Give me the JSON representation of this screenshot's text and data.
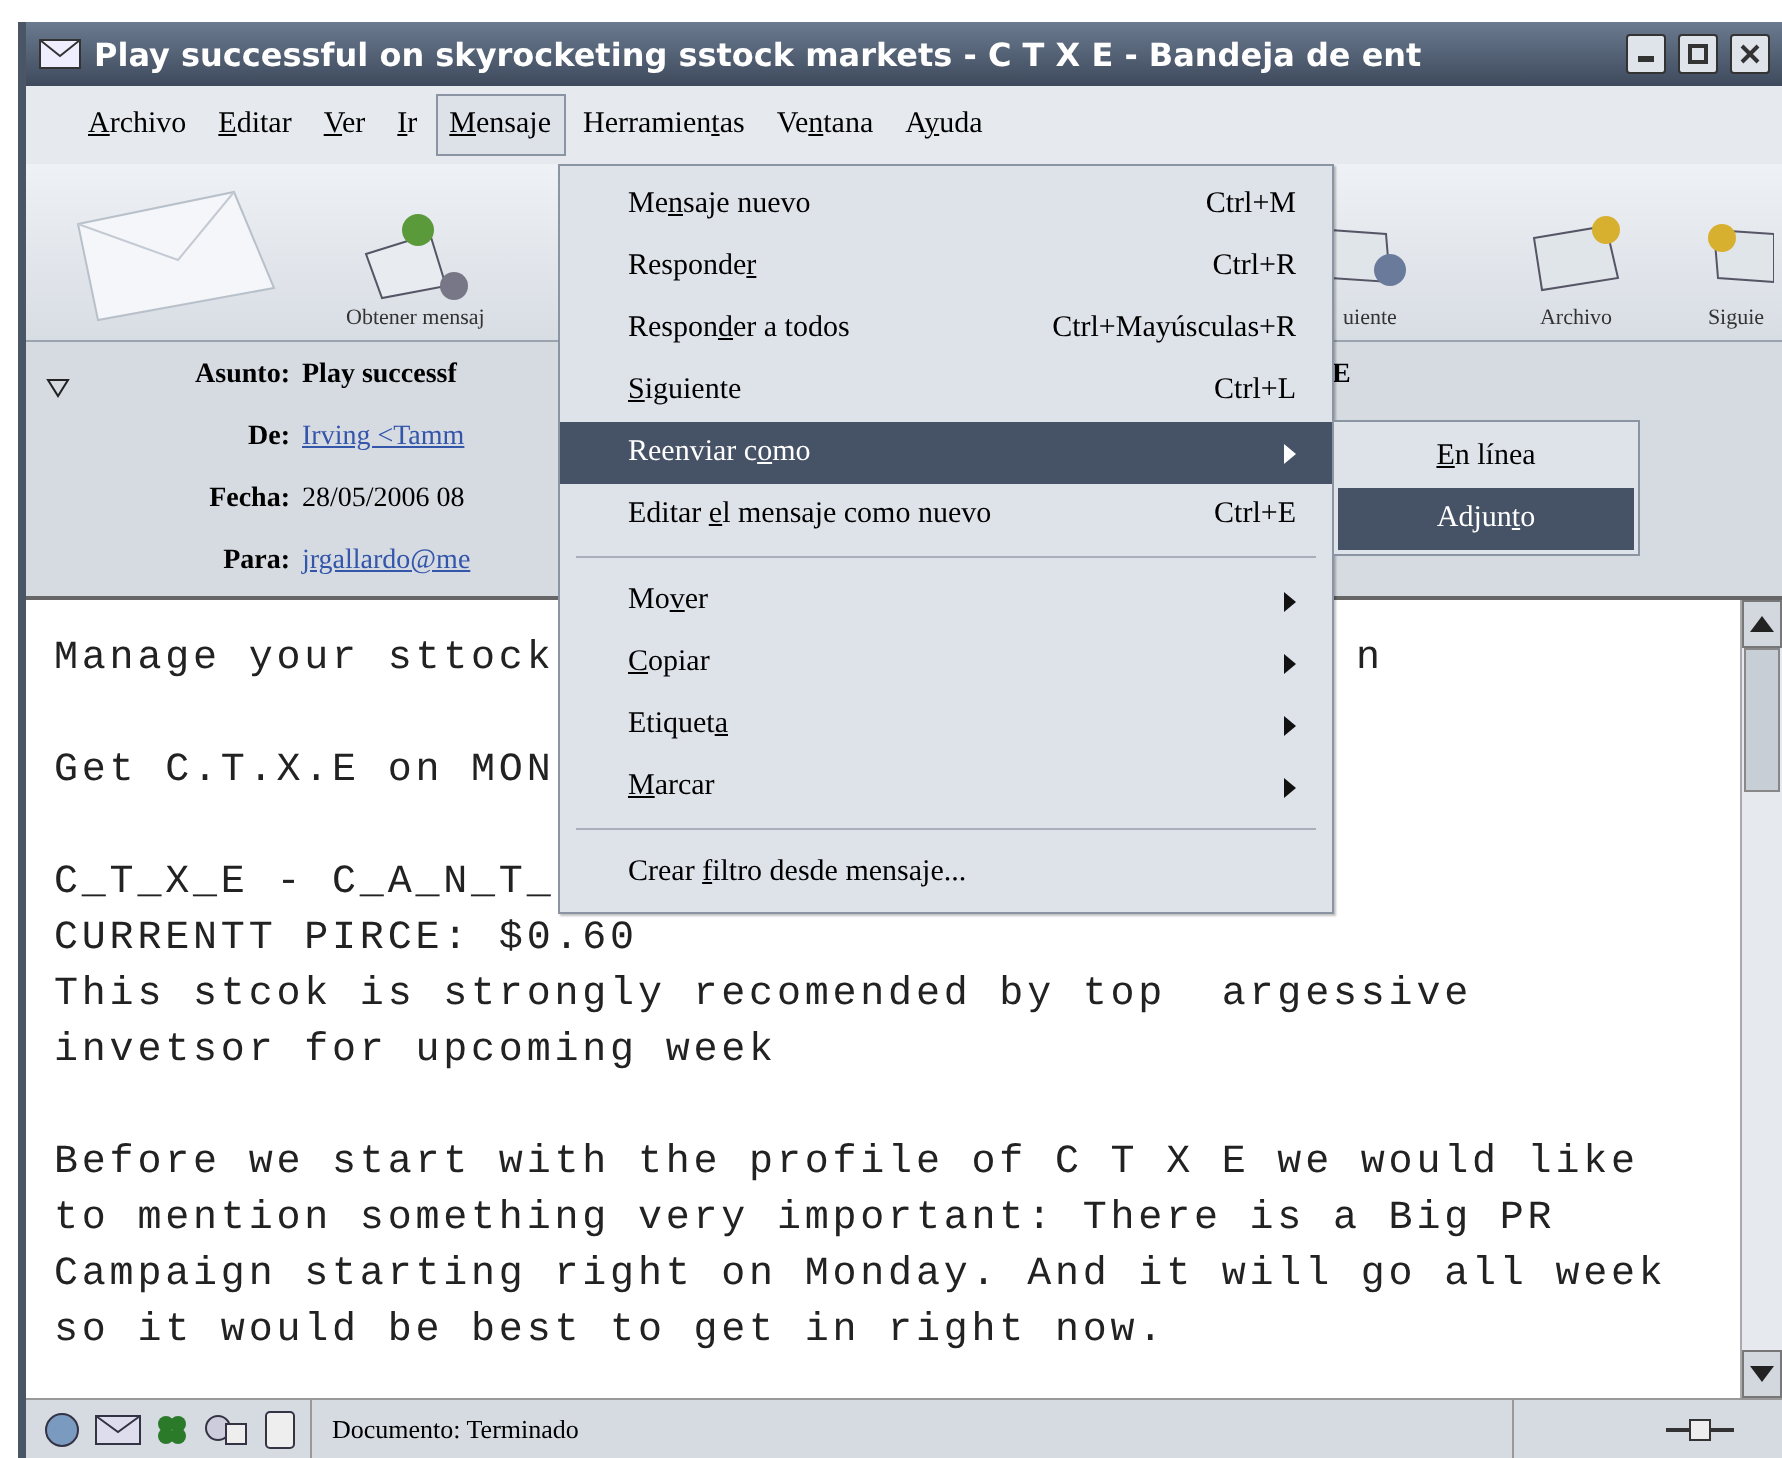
{
  "window": {
    "title": "Play successful on skyrocketing sstock markets - C T X E - Bandeja de ent"
  },
  "menubar": [
    {
      "label": {
        "key": "A",
        "post": "rchivo"
      },
      "selected": false
    },
    {
      "label": {
        "key": "E",
        "post": "ditar"
      },
      "selected": false
    },
    {
      "label": {
        "key": "V",
        "post": "er"
      },
      "selected": false
    },
    {
      "label": {
        "key": "I",
        "post": "r"
      },
      "selected": false
    },
    {
      "label": {
        "key": "M",
        "post": "ensaje"
      },
      "selected": true
    },
    {
      "label": {
        "pre": "Herramien",
        "key": "t",
        "post": "as"
      },
      "selected": false
    },
    {
      "label": {
        "pre": "Ve",
        "key": "n",
        "post": "tana"
      },
      "selected": false
    },
    {
      "label": {
        "pre": "A",
        "key": "y",
        "post": "uda"
      },
      "selected": false
    }
  ],
  "toolbar": [
    {
      "kind": "get",
      "label": "Obtener mensaj"
    },
    {
      "kind": "next",
      "label": "uiente"
    },
    {
      "kind": "file",
      "label": "Archivo"
    },
    {
      "kind": "next2",
      "label": "Siguie"
    }
  ],
  "header": {
    "expanded": true,
    "fields": [
      {
        "kind": "bold",
        "label": "Asunto:",
        "value": "Play successf",
        "tail": "E"
      },
      {
        "kind": "link",
        "label": "De:",
        "value": "Irving <Tamm"
      },
      {
        "kind": "plain",
        "label": "Fecha:",
        "value": "28/05/2006 08"
      },
      {
        "kind": "link",
        "label": "Para:",
        "value": "jrgallardo@me"
      }
    ]
  },
  "body": [
    [
      {
        "text": "Manage your sttock",
        "tail": "n"
      }
    ],
    [
      {
        "text": "Get C.T.X.E on MON"
      }
    ],
    [
      {
        "text": "C_T_X_E - C_A_N_T_"
      },
      {
        "text": "CURRENTT PIRCE: $0.60"
      },
      {
        "text": "This stcok is strongly recomended by top  argessive"
      },
      {
        "text": "invetsor for upcoming week"
      }
    ],
    [
      {
        "text": "Before we start with the profile of C T X E we would like"
      },
      {
        "text": "to mention something very important: There is a Big PR"
      },
      {
        "text": "Campaign starting right on Monday. And it will go all week"
      },
      {
        "text": "so it would be best to get in right now."
      }
    ]
  ],
  "menu": [
    {
      "kind": "item",
      "label": {
        "pre": "Me",
        "key": "n",
        "post": "saje nuevo"
      },
      "shortcut": "Ctrl+M",
      "selected": false
    },
    {
      "kind": "item",
      "label": {
        "pre": "Responde",
        "key": "r"
      },
      "shortcut": "Ctrl+R",
      "selected": false
    },
    {
      "kind": "item",
      "label": {
        "pre": "Respon",
        "key": "d",
        "post": "er a todos"
      },
      "shortcut": "Ctrl+Mayúsculas+R",
      "selected": false
    },
    {
      "kind": "item",
      "label": {
        "key": "S",
        "post": "iguiente"
      },
      "shortcut": "Ctrl+L",
      "selected": false
    },
    {
      "kind": "submenu",
      "label": {
        "pre": "Reenviar c",
        "key": "o",
        "post": "mo"
      },
      "selected": true
    },
    {
      "kind": "item",
      "label": {
        "pre": "Editar ",
        "key": "e",
        "post": "l mensaje como nuevo"
      },
      "shortcut": "Ctrl+E",
      "selected": false
    },
    {
      "kind": "separator"
    },
    {
      "kind": "submenu",
      "label": {
        "pre": "Mo",
        "key": "v",
        "post": "er"
      },
      "selected": false
    },
    {
      "kind": "submenu",
      "label": {
        "key": "C",
        "post": "opiar"
      },
      "selected": false
    },
    {
      "kind": "submenu",
      "label": {
        "pre": "Etiquet",
        "key": "a"
      },
      "selected": false
    },
    {
      "kind": "submenu",
      "label": {
        "key": "M",
        "post": "arcar"
      },
      "selected": false
    },
    {
      "kind": "separator"
    },
    {
      "kind": "item",
      "label": {
        "pre": "Crear ",
        "key": "f",
        "post": "iltro desde mensaje..."
      },
      "selected": false
    }
  ],
  "submenu": [
    {
      "label": {
        "key": "E",
        "post": "n línea"
      },
      "selected": false
    },
    {
      "label": {
        "pre": "Adjun",
        "key": "t",
        "post": "o"
      },
      "selected": true
    }
  ],
  "status_bar": {
    "text": "Documento: Terminado"
  }
}
